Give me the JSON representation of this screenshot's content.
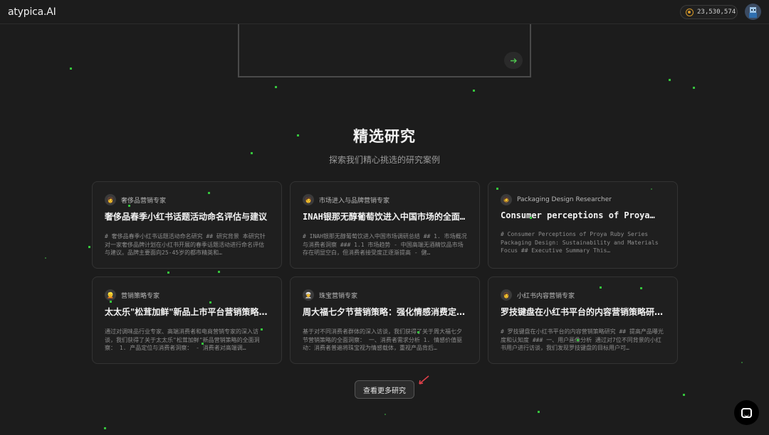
{
  "app": {
    "logo": "atypica.AI"
  },
  "header": {
    "token_count": "23,530,574",
    "coin_icon": "coin-icon",
    "avatar_icon": "user-avatar-icon"
  },
  "composer": {
    "send_icon": "arrow-right-icon"
  },
  "featured": {
    "title": "精选研究",
    "subtitle": "探索我们精心挑选的研究案例",
    "cards": [
      {
        "persona": "奢侈品营销专家",
        "persona_emoji": "👩",
        "title": "奢侈品春季小红书话题活动命名评估与建议",
        "body": "# 奢侈品春季小红书话题活动命名研究 ## 研究背景 本研究针对一家奢侈品牌计划在小红书开展的春季话题活动进行命名评估与建议。品牌主要面向25-45岁的都市精英和…"
      },
      {
        "persona": "市场进入与品牌营销专家",
        "persona_emoji": "🧑",
        "title": "INAH银那无醇葡萄饮进入中国市场的全面策…",
        "body": "# INAH银那无醇葡萄饮进入中国市场调研总结 ## 1. 市场概况与消费者洞察 ### 1.1 市场趋势 - 中国高端无酒精饮品市场存在明显空白，但消费者接受度正逐渐提高 - 健…"
      },
      {
        "persona": "Packaging Design Researcher",
        "persona_emoji": "🧔",
        "title": "Consumer perceptions of Proya…",
        "body": "# Consumer Perceptions of Proya Ruby Series Packaging Design: Sustainability and Materials Focus ## Executive Summary This…"
      },
      {
        "persona": "营销策略专家",
        "persona_emoji": "👱",
        "title": "太太乐\"松茸加鲜\"新品上市平台营销策略研究",
        "body": "通过对调味品行业专家、高端消费者和电商营销专家的深入访谈，我们获得了关于太太乐\"松茸加鲜\"新品营销策略的全面洞察： 1. 产品定位与消费者洞察： - 消费者对高端调…"
      },
      {
        "persona": "珠宝营销专家",
        "persona_emoji": "👳",
        "title": "周大福七夕节营销策略：强化情感消费定位…",
        "body": "基于对不同消费者群体的深入访谈，我们获得了关于周大福七夕节营销策略的全面洞察： 一、消费者需求分析 1. 情感价值驱动：消费者普遍将珠宝视为情感载体，重视产品背后…"
      },
      {
        "persona": "小红书内容营销专家",
        "persona_emoji": "👩",
        "title": "罗技键盘在小红书平台的内容营销策略研究…",
        "body": "# 罗技键盘在小红书平台的内容营销策略研究 ## 提高产品曝光度和认知度 ### 一、用户画像分析 通过对7位不同背景的小红书用户进行访谈，我们发现罗技键盘的目标用户可…"
      }
    ],
    "more_button": "查看更多研究"
  },
  "support": {
    "chat_icon": "chat-bubble-icon"
  },
  "colors": {
    "accent": "#35c43c",
    "background": "#1c1c1c",
    "coin": "#d89a2a"
  }
}
